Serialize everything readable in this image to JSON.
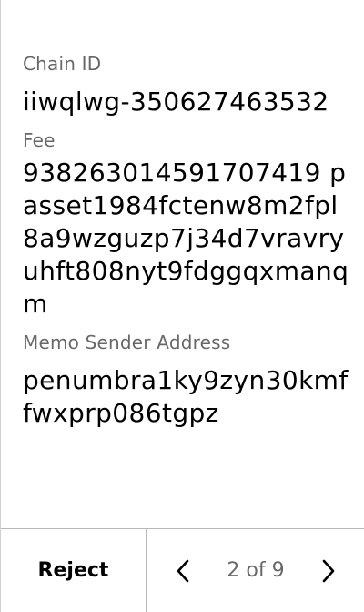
{
  "fields": [
    {
      "label": "Chain ID",
      "value": "iiwqlwg-350627463532"
    },
    {
      "label": "Fee",
      "value": "938263014591707419 passet1984fctenw8m2fpl8a9wzguzp7j34d7vravryuhft808nyt9fdggqxmanqm"
    },
    {
      "label": "Memo Sender Address",
      "value": "penumbra1ky9zyn30kmffwxprp086tgpz"
    }
  ],
  "footer": {
    "reject_label": "Reject",
    "page_indicator": "2 of 9",
    "prev_icon": "chevron-left-icon",
    "next_icon": "chevron-right-icon"
  },
  "colors": {
    "label": "#686868",
    "value": "#000000",
    "divider": "#b8b8b8"
  }
}
